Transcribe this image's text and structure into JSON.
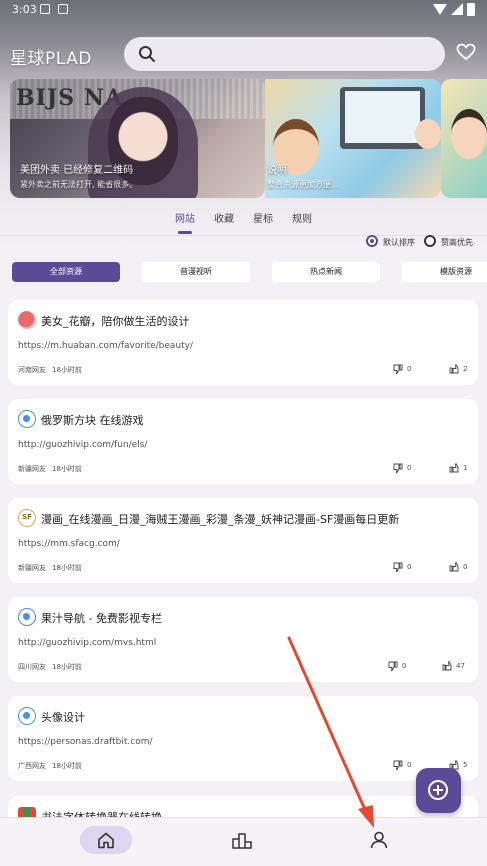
{
  "status_bar": {
    "time": "3:03"
  },
  "header": {
    "title": "星球PLAD",
    "search_placeholder": ""
  },
  "banners": [
    {
      "headline": "BIJS NA",
      "title": "美团外卖 已经修复二维码",
      "subtitle": "紧外卖之前无法打开, 能省很多。"
    },
    {
      "title": "说明",
      "subtitle": "整合资源更加方便..."
    },
    {
      "title": "",
      "subtitle": ""
    }
  ],
  "tabs": [
    {
      "label": "网站",
      "active": true
    },
    {
      "label": "收藏",
      "active": false
    },
    {
      "label": "星标",
      "active": false
    },
    {
      "label": "规则",
      "active": false
    }
  ],
  "sort_options": [
    {
      "label": "默认排序",
      "selected": true
    },
    {
      "label": "赞高优先",
      "selected": false
    }
  ],
  "categories": [
    {
      "label": "全部资源",
      "active": true
    },
    {
      "label": "音漫视听",
      "active": false
    },
    {
      "label": "热点新闻",
      "active": false
    },
    {
      "label": "模版资源",
      "active": false
    }
  ],
  "cards": [
    {
      "icon": "red-flower-icon",
      "title": "美女_花瓣，陪你做生活的设计",
      "url": "https://m.huaban.com/favorite/beauty/",
      "author": "河南网友",
      "time": "18小时前",
      "dislikes": "0",
      "likes": "2"
    },
    {
      "icon": "site-icon",
      "title": "俄罗斯方块 在线游戏",
      "url": "http://guozhivip.com/fun/els/",
      "author": "新疆网友",
      "time": "18小时前",
      "dislikes": "0",
      "likes": "1"
    },
    {
      "icon": "sf-icon",
      "icon_text": "SF",
      "title": "漫画_在线漫画_日漫_海贼王漫画_彩漫_条漫_妖神记漫画-SF漫画每日更新",
      "url": "https://mm.sfacg.com/",
      "author": "新疆网友",
      "time": "18小时前",
      "dislikes": "0",
      "likes": "0"
    },
    {
      "icon": "site-icon",
      "title": "果汁导航 - 免费影视专栏",
      "url": "http://guozhivip.com/mvs.html",
      "author": "四川网友",
      "time": "18小时前",
      "dislikes": "0",
      "likes": "47"
    },
    {
      "icon": "site-icon",
      "title": "头像设计",
      "url": "https://personas.draftbit.com/",
      "author": "广西网友",
      "time": "18小时前",
      "dislikes": "0",
      "likes": "5"
    },
    {
      "icon": "book-icon",
      "title": "书法字体转换器在线转换",
      "url": "",
      "author": "",
      "time": "",
      "dislikes": "",
      "likes": ""
    }
  ],
  "colors": {
    "accent": "#5b4a96",
    "annotation_arrow": "#e24a33"
  },
  "bottom_nav": [
    {
      "name": "home",
      "icon": "home-icon",
      "active": true
    },
    {
      "name": "ranking",
      "icon": "podium-icon",
      "active": false
    },
    {
      "name": "profile",
      "icon": "user-icon",
      "active": false
    }
  ]
}
